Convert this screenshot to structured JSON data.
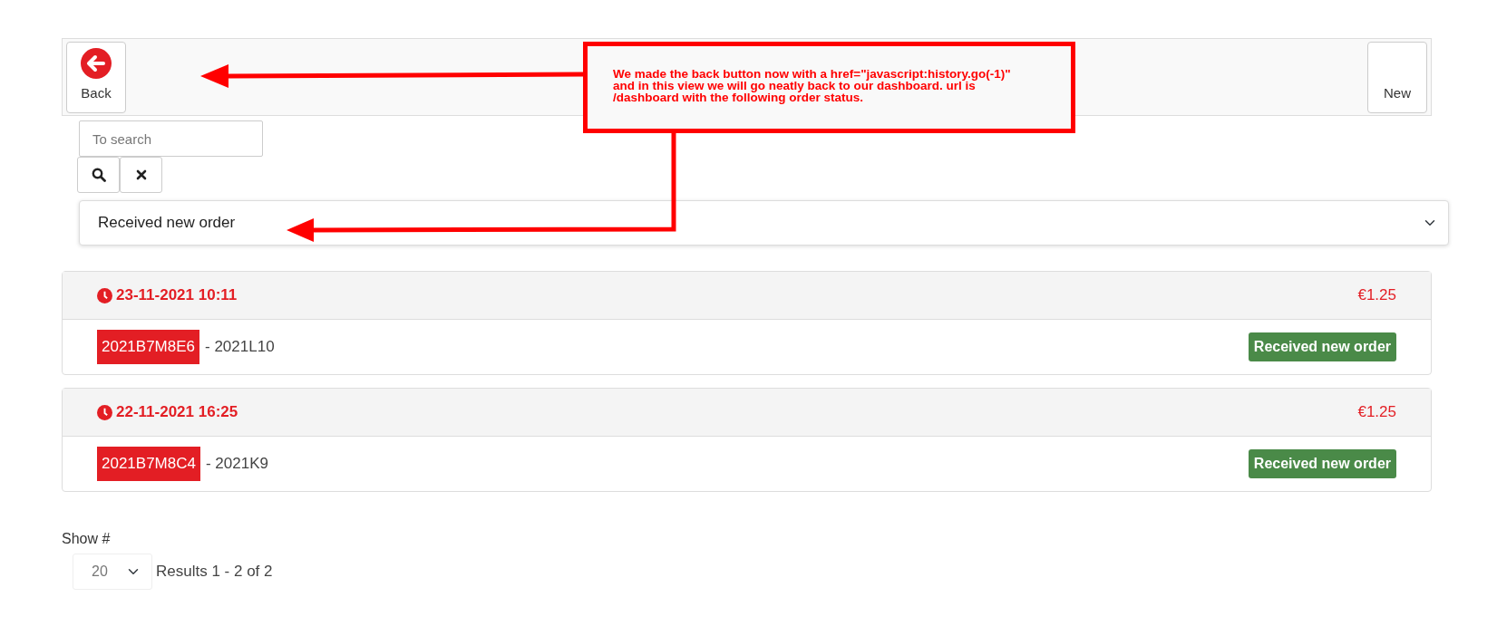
{
  "toolbar": {
    "back_label": "Back",
    "new_label": "New"
  },
  "search": {
    "placeholder": "To search"
  },
  "status_filter": {
    "value": "Received new order"
  },
  "orders": [
    {
      "datetime": "23-11-2021 10:11",
      "amount": "€1.25",
      "code": "2021B7M8E6",
      "reference": "- 2021L10",
      "status": "Received new order",
      "color": "#4a8a48"
    },
    {
      "datetime": "22-11-2021 16:25",
      "amount": "€1.25",
      "code": "2021B7M8C4",
      "reference": "- 2021K9",
      "status": "Received new order",
      "color": "#4a8a48"
    }
  ],
  "pagination": {
    "label": "Show #",
    "page_size": "20",
    "results": "Results 1 - 2 of 2"
  },
  "annotation": {
    "lines": [
      "We made the back button now with a href=\"javascript:history.go(-1)\"",
      "and in this view we will go neatly back to our dashboard. url is",
      "/dashboard with the following order status."
    ]
  }
}
